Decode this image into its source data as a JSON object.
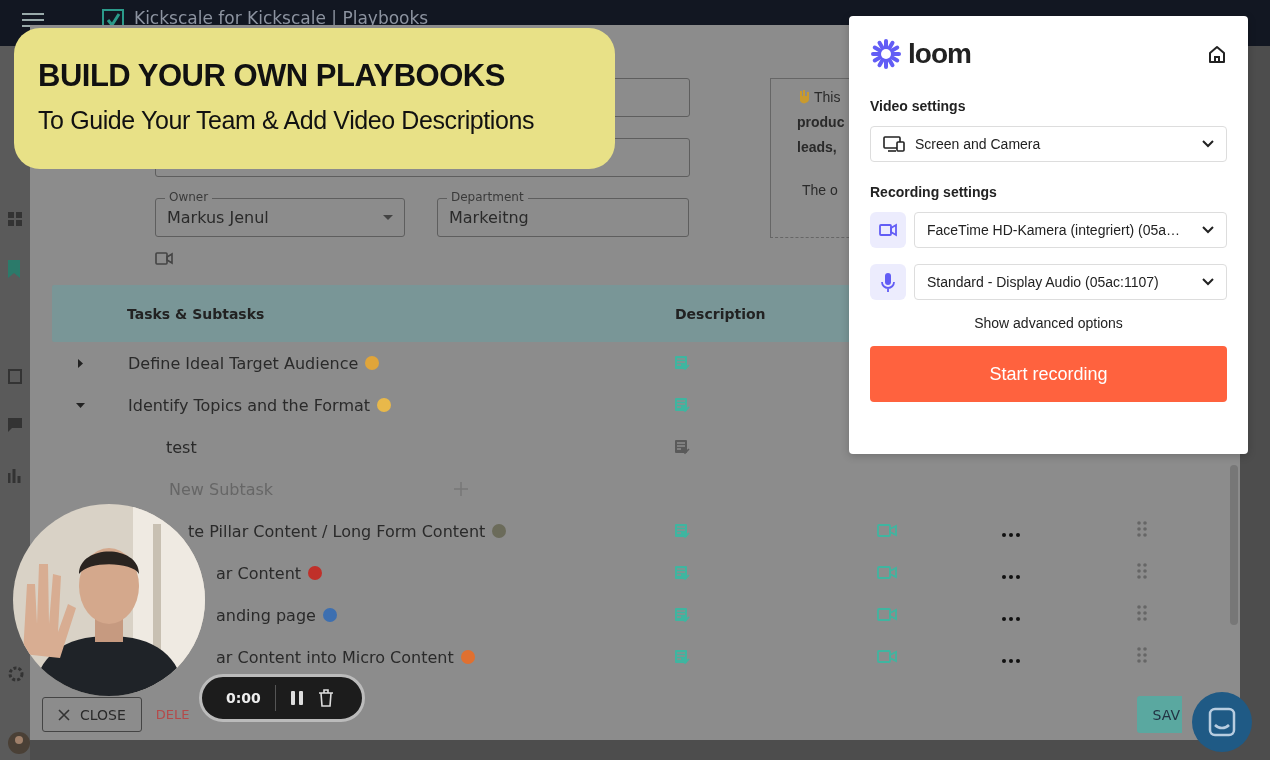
{
  "header": {
    "title": "Kickscale for Kickscale | Playbooks"
  },
  "banner": {
    "title": "BUILD YOUR OWN PLAYBOOKS",
    "subtitle": "To Guide Your Team & Add Video Descriptions"
  },
  "form": {
    "owner": {
      "label": "Owner",
      "value": "Markus Jenul"
    },
    "department": {
      "label": "Department",
      "value": "Markeitng"
    },
    "description_lines": [
      {
        "text": "This",
        "emoji": true,
        "bold": false
      },
      {
        "text": "produc",
        "emoji": false,
        "bold": true
      },
      {
        "text": "leads,",
        "emoji": false,
        "bold": true
      },
      {
        "text": "The o",
        "emoji": false,
        "bold": false
      }
    ]
  },
  "table": {
    "columns": [
      "Tasks & Subtasks",
      "Description"
    ],
    "rows": [
      {
        "kind": "task",
        "expanded": false,
        "title": "Define Ideal Target Audience",
        "color": "#e0a53a",
        "described": true
      },
      {
        "kind": "task",
        "expanded": true,
        "title": "Identify Topics and the Format",
        "color": "#e8b84a",
        "described": true
      },
      {
        "kind": "subtask",
        "title": "test",
        "described": false
      },
      {
        "kind": "new",
        "title": "New Subtask"
      },
      {
        "kind": "cut",
        "title": "te Pillar Content / Long Form Content",
        "color": "#6b6b5a",
        "described": true
      },
      {
        "kind": "cut",
        "title": "ar Content",
        "color": "#c0302a",
        "described": true
      },
      {
        "kind": "cut",
        "title": "anding page",
        "color": "#3d6fb0",
        "described": true
      },
      {
        "kind": "cut",
        "title": "ar Content into Micro Content",
        "color": "#e07030",
        "described": true
      }
    ]
  },
  "footer": {
    "close": "CLOSE",
    "delete": "DELE",
    "save": "SAV"
  },
  "recorder": {
    "time": "0:00"
  },
  "loom": {
    "logo": "loom",
    "video_heading": "Video settings",
    "video_source": "Screen and Camera",
    "recording_heading": "Recording settings",
    "camera": "FaceTime HD-Kamera (integriert) (05a…",
    "microphone": "Standard - Display Audio (05ac:1107)",
    "advanced": "Show advanced options",
    "start": "Start recording"
  }
}
